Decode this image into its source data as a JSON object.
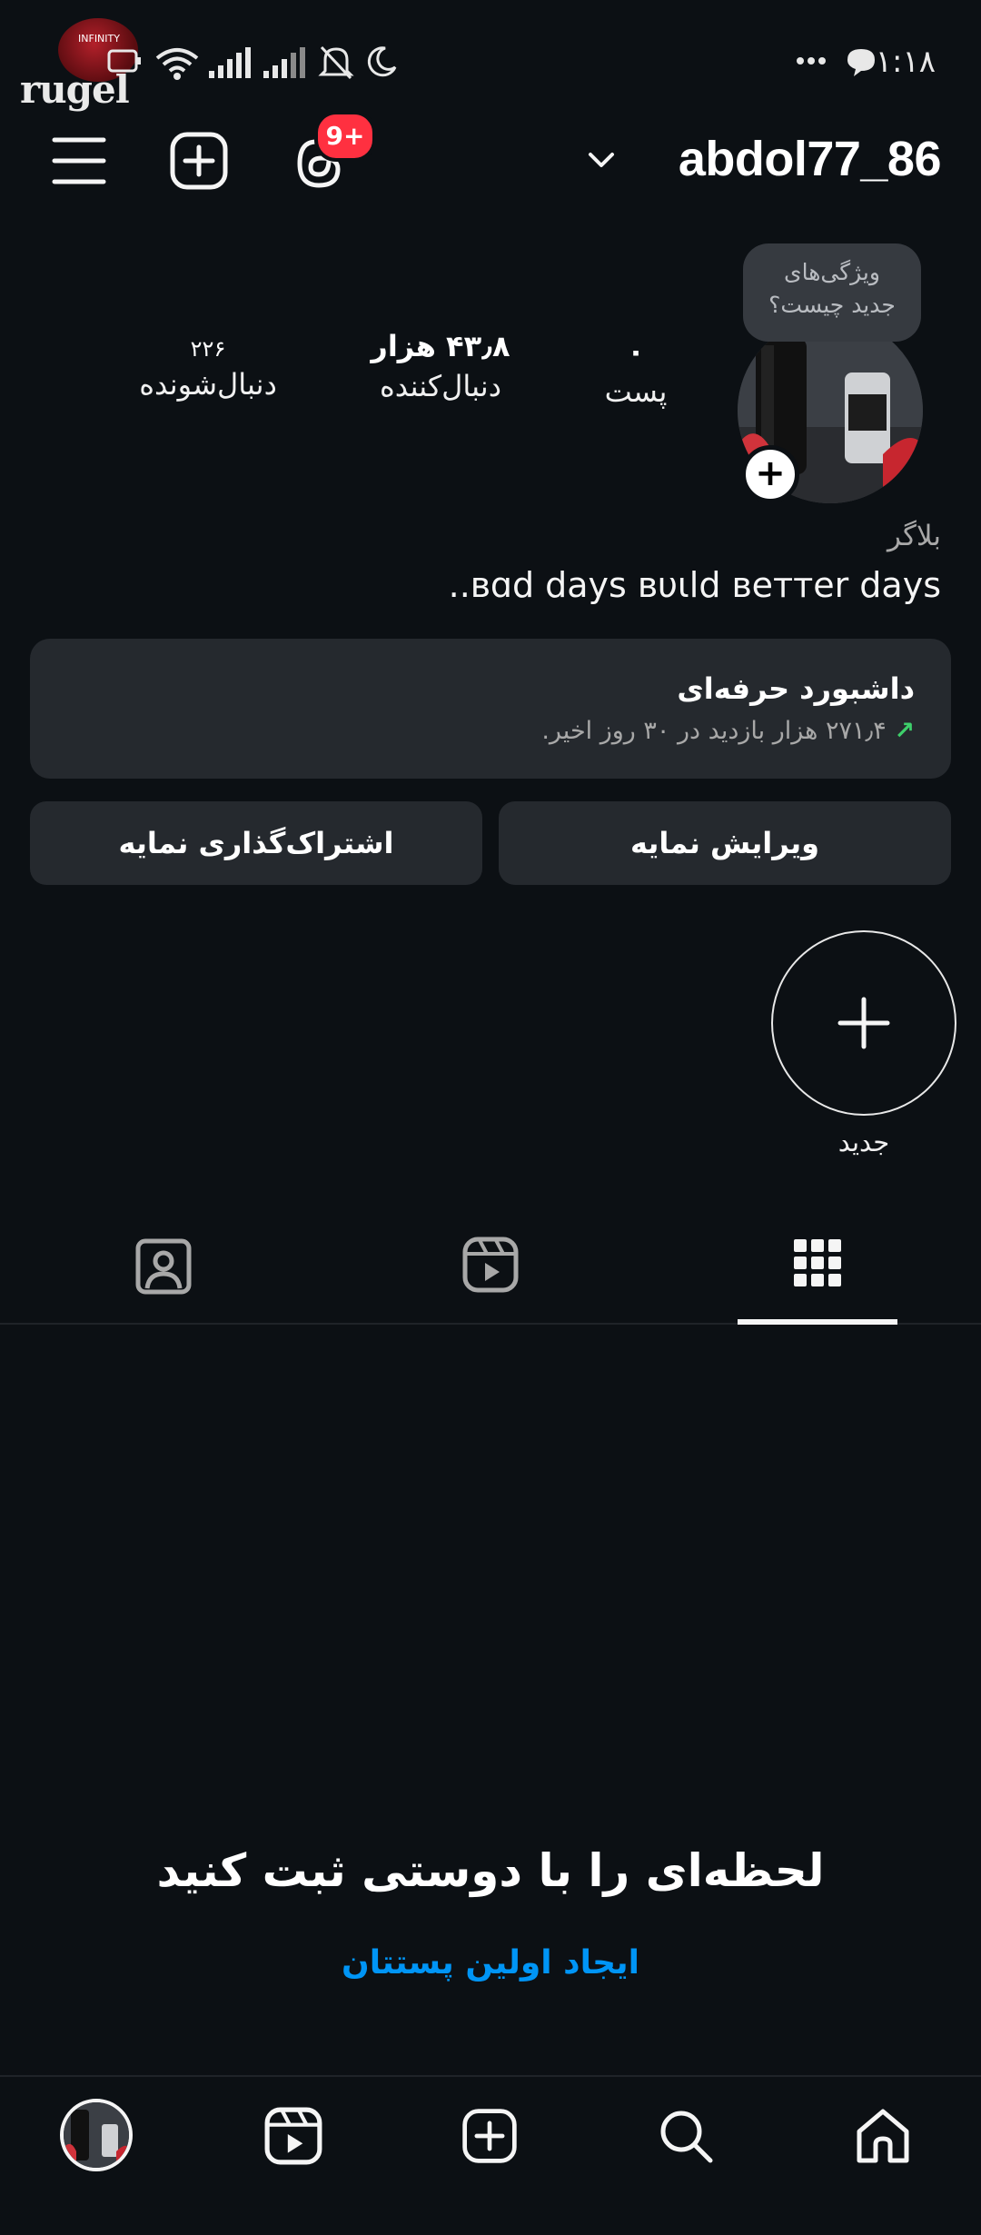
{
  "status_bar": {
    "time": "۱:۱۸",
    "watermark_text": "rugel",
    "watermark_inner": "INFINITY",
    "icons": [
      "battery-icon",
      "wifi-icon",
      "signal-icon",
      "signal-icon",
      "bell-muted-icon",
      "moon-icon",
      "more-dots-icon",
      "chat-bubble-icon"
    ]
  },
  "header": {
    "username": "abdol77_86",
    "notification_badge": "9+",
    "icons": [
      "menu-icon",
      "create-icon",
      "threads-icon",
      "chevron-down-icon"
    ]
  },
  "profile": {
    "bubble": [
      "ویژگی‌های",
      "جدید چیست؟"
    ],
    "stats": [
      {
        "value": "۰",
        "label": "پست"
      },
      {
        "value": "۴۳٫۸ هزار",
        "label": "دنبال‌کننده"
      },
      {
        "value": "۲۲۶",
        "label": "دنبال‌شونده"
      }
    ],
    "category": "بلاگر",
    "bio": "..ʙɑd days ʙυιld ʙeттer days"
  },
  "dashboard": {
    "title": "داشبورد حرفه‌ای",
    "subtitle": "۲۷۱٫۴ هزار بازدید در ۳۰ روز اخیر.",
    "accent": "#3ecf6b"
  },
  "buttons": {
    "edit": "ویرایش نمایه",
    "share": "اشتراک‌گذاری نمایه"
  },
  "highlights": {
    "new_label": "جدید"
  },
  "tabs": [
    "grid-icon",
    "reels-icon",
    "tagged-icon"
  ],
  "empty_state": {
    "title": "لحظه‌ای را با دوستی ثبت کنید",
    "link": "ایجاد اولین پستتان",
    "link_color": "#0095f6"
  },
  "bottom_nav": [
    "home-icon",
    "search-icon",
    "create-icon",
    "reels-icon",
    "profile-avatar"
  ]
}
